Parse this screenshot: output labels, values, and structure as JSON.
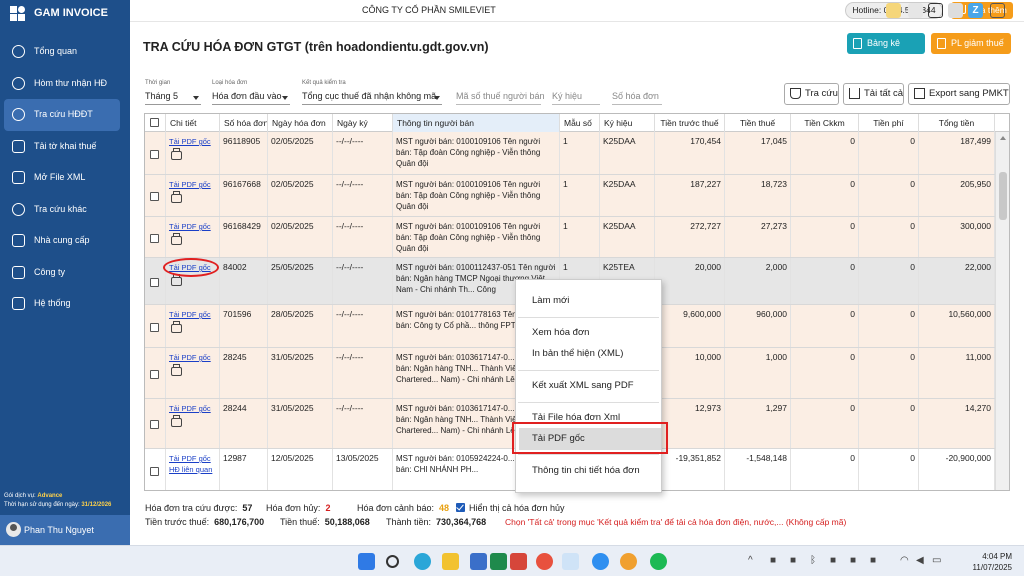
{
  "app": {
    "name": "GAM INVOICE"
  },
  "topbar": {
    "company": "CÔNG TY CỔ PHẦN SMILEVIET",
    "hotline": "Hotline: 0904.506.344",
    "buy_label": "Mua thêm"
  },
  "sidebar": {
    "items": [
      {
        "label": "Tổng quan"
      },
      {
        "label": "Hòm thư nhận HĐ"
      },
      {
        "label": "Tra cứu HĐĐT"
      },
      {
        "label": "Tải tờ khai thuế"
      },
      {
        "label": "Mở File XML"
      },
      {
        "label": "Tra cứu khác"
      },
      {
        "label": "Nhà cung cấp"
      },
      {
        "label": "Công ty"
      },
      {
        "label": "Hệ thống"
      }
    ],
    "service_label": "Gói dịch vụ:",
    "service_value": "Advance",
    "expiry_label": "Thời hạn sử dụng đến ngày:",
    "expiry_value": "31/12/2026",
    "user": "Phan Thu Nguyet"
  },
  "page": {
    "title": "TRA CỨU HÓA ĐƠN GTGT (trên hoadondientu.gdt.gov.vn)",
    "btn_bangke": "Bảng kê thuế",
    "btn_pl": "PL giảm thuế"
  },
  "filters": {
    "period_label": "Thời gian",
    "period_value": "Tháng 5",
    "type_label": "Loại hóa đơn",
    "type_value": "Hóa đơn đầu vào",
    "result_label": "Kết quả kiểm tra",
    "result_value": "Tổng cục thuế đã nhận không mã",
    "mst_placeholder": "Mã số thuế người bán",
    "symbol_placeholder": "Ký hiệu",
    "number_placeholder": "Số hóa đơn"
  },
  "toolbar": {
    "search": "Tra cứu",
    "download_all": "Tải tất cả",
    "export": "Export sang PMKT"
  },
  "table": {
    "headers": [
      "",
      "Chi tiết",
      "Số hóa đơn",
      "Ngày hóa đơn",
      "Ngày ký",
      "Thông tin người bán",
      "Mẫu số",
      "Ký hiệu",
      "Tiền trước thuế",
      "Tiền thuế",
      "Tiền Ckkm",
      "Tiền phí",
      "Tổng tiền"
    ],
    "pdf_label": "Tải PDF gốc",
    "rows": [
      {
        "no": "96118905",
        "date": "02/05/2025",
        "sign": "--/--/----",
        "seller": "MST người bán: 0100109106 Tên người bán: Tập đoàn Công nghiệp - Viễn thông Quân đội",
        "form": "1",
        "symbol": "K25DAA",
        "pre": "170,454",
        "tax": "17,045",
        "ck": "0",
        "fee": "0",
        "total": "187,499"
      },
      {
        "no": "96167668",
        "date": "02/05/2025",
        "sign": "--/--/----",
        "seller": "MST người bán: 0100109106 Tên người bán: Tập đoàn Công nghiệp - Viễn thông Quân đội",
        "form": "1",
        "symbol": "K25DAA",
        "pre": "187,227",
        "tax": "18,723",
        "ck": "0",
        "fee": "0",
        "total": "205,950"
      },
      {
        "no": "96168429",
        "date": "02/05/2025",
        "sign": "--/--/----",
        "seller": "MST người bán: 0100109106 Tên người bán: Tập đoàn Công nghiệp - Viễn thông Quân đội",
        "form": "1",
        "symbol": "K25DAA",
        "pre": "272,727",
        "tax": "27,273",
        "ck": "0",
        "fee": "0",
        "total": "300,000"
      },
      {
        "no": "84002",
        "date": "25/05/2025",
        "sign": "--/--/----",
        "seller": "MST người bán: 0100112437-051 Tên người bán: Ngân hàng TMCP Ngoại thương Việt Nam - Chi nhánh Th... Công",
        "form": "1",
        "symbol": "K25TEA",
        "pre": "20,000",
        "tax": "2,000",
        "ck": "0",
        "fee": "0",
        "total": "22,000"
      },
      {
        "no": "701596",
        "date": "28/05/2025",
        "sign": "--/--/----",
        "seller": "MST người bán: 0101778163 Tên người bán: Công ty Cổ phầ... thông FPT",
        "form": "",
        "symbol": "",
        "pre": "9,600,000",
        "tax": "960,000",
        "ck": "0",
        "fee": "0",
        "total": "10,560,000"
      },
      {
        "no": "28245",
        "date": "31/05/2025",
        "sign": "--/--/----",
        "seller": "MST người bán: 0103617147-0... Tên người bán: Ngân hàng TNH... Thành Viên Standard Chartered... Nam) - Chi nhánh Lê Đại Hành",
        "form": "",
        "symbol": "",
        "pre": "10,000",
        "tax": "1,000",
        "ck": "0",
        "fee": "0",
        "total": "11,000"
      },
      {
        "no": "28244",
        "date": "31/05/2025",
        "sign": "--/--/----",
        "seller": "MST người bán: 0103617147-0... Tên người bán: Ngân hàng TNH... Thành Viên Standard Chartered... Nam) - Chi nhánh Lê Đại Hành",
        "form": "",
        "symbol": "",
        "pre": "12,973",
        "tax": "1,297",
        "ck": "0",
        "fee": "0",
        "total": "14,270"
      },
      {
        "no": "12987",
        "date": "12/05/2025",
        "sign": "13/05/2025",
        "seller": "MST người bán: 0105924224-0... Tên người bán: CHI NHÁNH PH...",
        "form": "",
        "symbol": "",
        "pre": "-19,351,852",
        "tax": "-1,548,148",
        "ck": "0",
        "fee": "0",
        "total": "-20,900,000"
      }
    ],
    "last_row_extra": "HĐ liên quan"
  },
  "context_menu": {
    "items": [
      "Làm mới",
      "Xem hóa đơn",
      "In bản thể hiện (XML)",
      "Kết xuất XML sang PDF",
      "Tải File hóa đơn Xml",
      "Tải PDF gốc",
      "Thông tin chi tiết hóa đơn"
    ]
  },
  "summary": {
    "found_label": "Hóa đơn tra cứu được:",
    "found": "57",
    "cancel_label": "Hóa đơn hủy:",
    "cancel": "2",
    "warn_label": "Hóa đơn cảnh báo:",
    "warn": "48",
    "show_cancel_label": "Hiển thị cả hóa đơn hủy",
    "pre_label": "Tiền trước thuế:",
    "pre": "680,176,700",
    "tax_label": "Tiền thuế:",
    "tax": "50,188,068",
    "total_label": "Thành tiền:",
    "total": "730,364,768",
    "note": "Chọn 'Tất cả' trong mục 'Kết quả kiểm tra' để tải cả hóa đơn điện, nước,... (Không cấp mã)"
  },
  "taskbar": {
    "time": "4:04 PM",
    "date": "11/07/2025"
  },
  "colors": {
    "sidebar": "#1e4f8a",
    "accent_orange": "#f59c1a",
    "teal": "#1aa1b5",
    "row_bg": "#fbeee4",
    "highlight": "#e02020"
  }
}
